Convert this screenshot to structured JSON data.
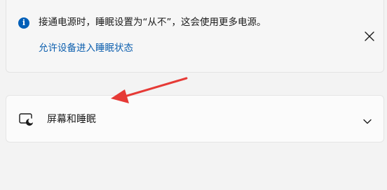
{
  "notice": {
    "icon": "info-icon",
    "message": "接通电源时，睡眠设置为“从不”，这会使用更多电源。",
    "link_text": "允许设备进入睡眠状态",
    "close_icon": "close-icon"
  },
  "setting": {
    "icon": "screen-sleep-icon",
    "label": "屏幕和睡眠",
    "expand_icon": "chevron-down-icon"
  },
  "colors": {
    "accent": "#005fb8",
    "link": "#0b5eae",
    "annotation_arrow": "#e63a36"
  }
}
